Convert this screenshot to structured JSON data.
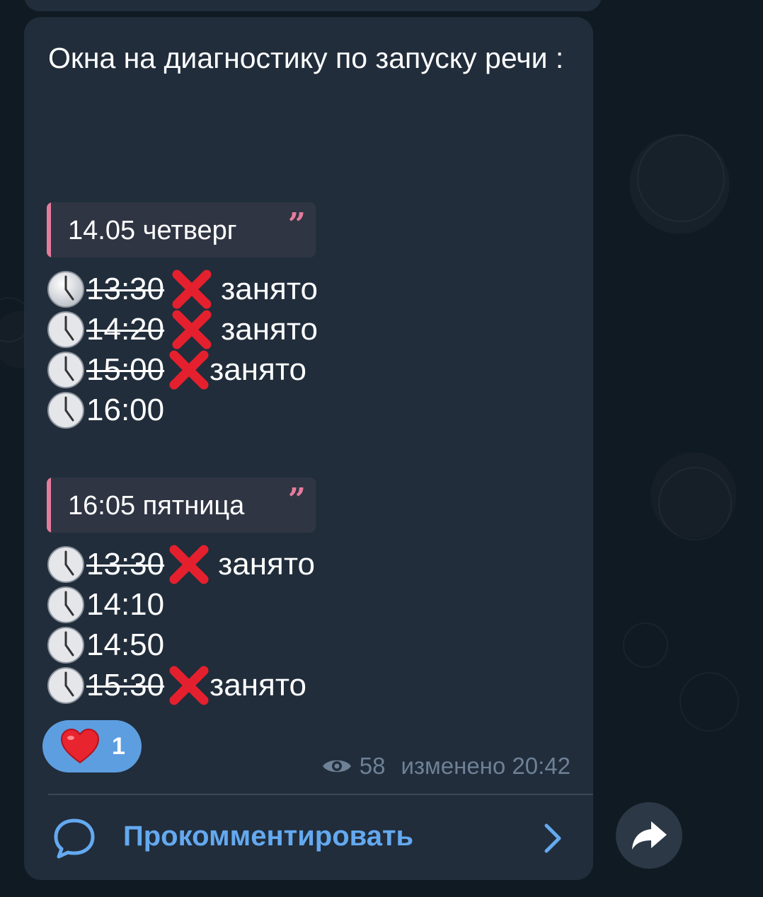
{
  "post": {
    "title": "Окна на диагностику по запуску речи :",
    "days": [
      {
        "label": "14.05 четверг",
        "slots": [
          {
            "time": "13:30",
            "taken": true,
            "status": "занято"
          },
          {
            "time": "14:20",
            "taken": true,
            "status": "занято"
          },
          {
            "time": "15:00",
            "taken": true,
            "status": "занято"
          },
          {
            "time": "16:00",
            "taken": false,
            "status": ""
          }
        ]
      },
      {
        "label": "16:05 пятница",
        "slots": [
          {
            "time": "13:30",
            "taken": true,
            "status": "занято"
          },
          {
            "time": "14:10",
            "taken": false,
            "status": ""
          },
          {
            "time": "14:50",
            "taken": false,
            "status": ""
          },
          {
            "time": "15:30",
            "taken": true,
            "status": "занято"
          }
        ]
      }
    ],
    "quote_mark": "”"
  },
  "reaction": {
    "emoji": "heart-icon",
    "count": "1"
  },
  "meta": {
    "views": "58",
    "edited": "изменено 20:42"
  },
  "comment": {
    "label": "Прокомментировать"
  },
  "colors": {
    "bubble": "#212d3b",
    "quote_accent": "#e57c9c",
    "link": "#64a9f0",
    "reaction_bg": "#5d9ee0",
    "meta": "#6e8196"
  }
}
